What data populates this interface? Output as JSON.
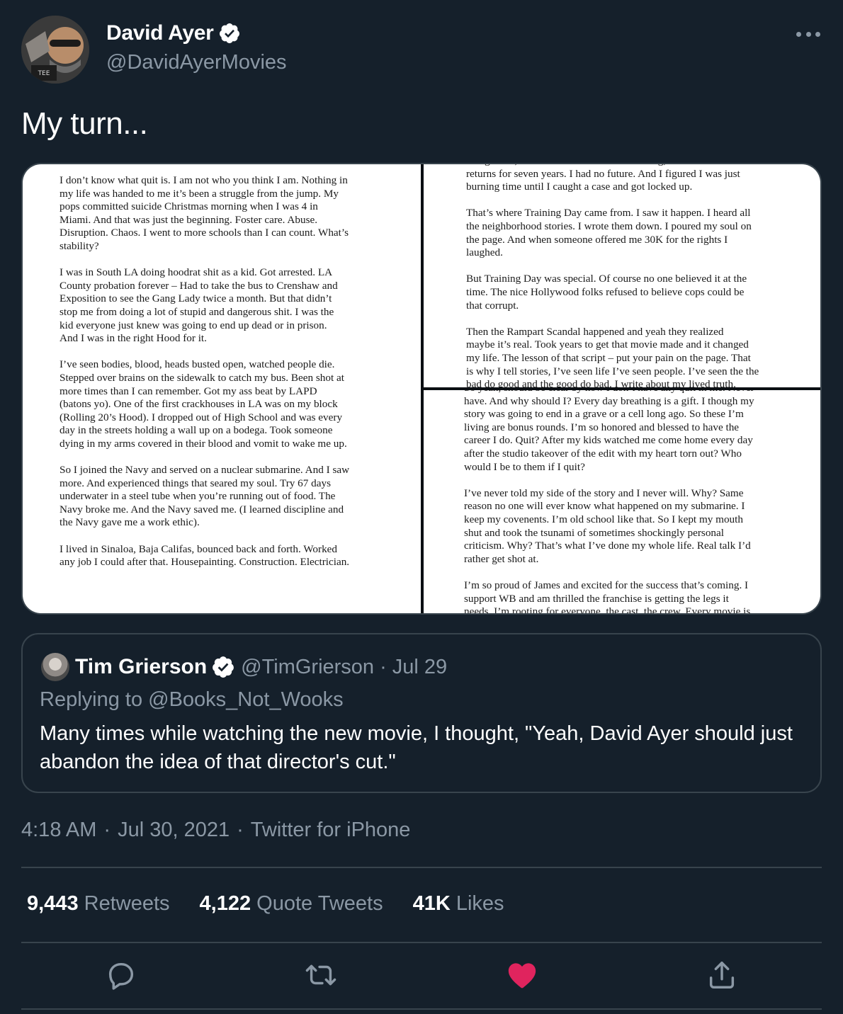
{
  "author": {
    "display_name": "David Ayer",
    "handle": "@DavidAyerMovies",
    "avatar_icon": "avatar-photo"
  },
  "tweet": {
    "text": "My turn..."
  },
  "media": {
    "left_page": [
      "I don’t know what quit is. I am not who you think I am. Nothing in\nmy life was handed to me it’s been a struggle from the jump. My\npops committed suicide Christmas morning when I was 4 in\nMiami. And that was just the beginning. Foster care. Abuse.\nDisruption. Chaos. I went to more schools than I can count. What’s\nstability?",
      "I was in South LA doing hoodrat shit as a kid. Got arrested. LA\nCounty probation forever – Had to take the bus to Crenshaw and\nExposition to see the Gang Lady twice a month. But that didn’t\nstop me from doing a lot of stupid and dangerous shit. I was the\nkid everyone just knew was going to end up dead or in prison.\nAnd I was in the right Hood for it.",
      "I’ve seen bodies, blood, heads busted open, watched people die.\nStepped over brains on the sidewalk to catch my bus. Been shot at\nmore times than I can remember. Got my ass beat by LAPD\n(batons yo). One of the first crackhouses in LA was on my block\n(Rolling 20’s Hood). I dropped out of High School and was every\nday in the streets holding a wall up on a bodega. Took someone\ndying in my arms covered in their blood and vomit to wake me up.",
      "So I joined the Navy and served on a nuclear submarine. And I saw\nmore. And experienced things that seared my soul. Try 67 days\nunderwater in a steel tube when you’re running out of food. The\nNavy broke me. And the Navy saved me. (I learned discipline and\nthe Navy gave me a work ethic).",
      "I lived in Sinaloa, Baja Califas, bounced back and forth. Worked\nany job I could after that. Housepainting. Construction. Electrician."
    ],
    "top_right_page": [
      "refrigerator, I didn’t have a bed. I had nothing, didn’t file tax\nreturns for seven years. I had no future. And I figured I was just\nburning time until I caught a case and got locked up.",
      "That’s where Training Day came from. I saw it happen. I heard all\nthe neighborhood stories. I wrote them down. I poured my soul on\nthe page. And when someone offered me 30K for the rights I\nlaughed.",
      "But Training Day was special. Of course no one believed it at the\ntime. The nice Hollywood folks refused to believe cops could be\nthat corrupt.",
      "Then the Rampart Scandal happened and yeah they realized\nmaybe it’s real. Took years to get that movie made and it changed\nmy life. The lesson of that script – put your pain on the page. That\nis why I tell stories, I’ve seen life I’ve seen people. I’ve seen the the\nbad do good and the good do bad. I write about my lived truth."
    ],
    "bottom_right_page": [
      "So yeah, should be clear by now I don’t have any quit in me. Never\nhave. And why should I? Every day breathing is a gift. I though my\nstory was going to end in a grave or a cell long ago. So these I’m\nliving are bonus rounds. I’m so honored and blessed to have the\ncareer I do. Quit? After my kids watched me come home every day\nafter the studio takeover of the edit with my heart torn out? Who\nwould I be to them if I quit?",
      "I’ve never told my side of the story and I never will. Why? Same\nreason no one will ever know what happened on my submarine. I\nkeep my covenents. I’m old school like that. So I kept my mouth\nshut and took the tsunami of sometimes shockingly personal\ncriticism. Why? That’s what I’ve done my whole life. Real talk I’d\nrather get shot at.",
      "I’m so proud of James and excited for the success that’s coming. I\nsupport WB and am thrilled the franchise is getting the legs it\nneeds. I’m rooting for everyone, the cast, the crew. Every movie is"
    ]
  },
  "quoted_tweet": {
    "display_name": "Tim Grierson",
    "handle": "@TimGrierson",
    "separator": "·",
    "date": "Jul 29",
    "replying_to": "Replying to @Books_Not_Wooks",
    "text": "Many times while watching the new movie, I thought, \"Yeah, David Ayer should just abandon the idea of that director's cut.\""
  },
  "meta": {
    "time": "4:18 AM",
    "separator": "·",
    "date": "Jul 30, 2021",
    "source": "Twitter for iPhone"
  },
  "stats": {
    "retweets_count": "9,443",
    "retweets_label": "Retweets",
    "quote_count": "4,122",
    "quote_label": "Quote Tweets",
    "likes_count": "41K",
    "likes_label": "Likes"
  },
  "colors": {
    "background": "#15202b",
    "border": "#38444d",
    "secondary_text": "#8b98a5",
    "like_active": "#e0245e",
    "verified": "#ffffff"
  },
  "icons": {
    "verified": "verified-badge-icon",
    "more": "more-options-icon",
    "reply": "reply-icon",
    "retweet": "retweet-icon",
    "like": "heart-icon",
    "share": "share-icon"
  }
}
